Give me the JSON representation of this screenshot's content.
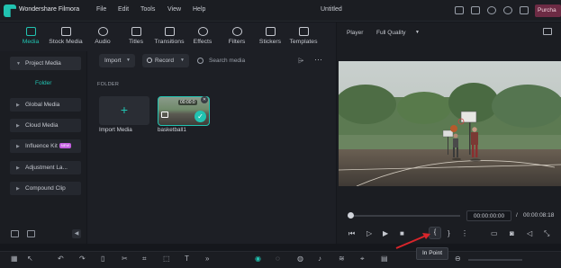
{
  "titlebar": {
    "app_name": "Wondershare Filmora",
    "menu": [
      "File",
      "Edit",
      "Tools",
      "View",
      "Help"
    ],
    "doc_title": "Untitled",
    "purchase": "Purcha"
  },
  "tabs": [
    "Media",
    "Stock Media",
    "Audio",
    "Titles",
    "Transitions",
    "Effects",
    "Filters",
    "Stickers",
    "Templates"
  ],
  "sidebar": {
    "items": [
      "Project Media",
      "Global Media",
      "Cloud Media",
      "Influence Kit",
      "Adjustment La...",
      "Compound Clip"
    ],
    "folder": "Folder",
    "new_badge": "NEW"
  },
  "media": {
    "import_label": "Import",
    "record_label": "Record",
    "search_placeholder": "Search media",
    "folder_header": "FOLDER",
    "import_card_label": "Import Media",
    "clip_name": "basketball1",
    "clip_duration": "00:00:0"
  },
  "player": {
    "label": "Player",
    "quality": "Full Quality",
    "current_time": "00:00:00:00",
    "separator": "/",
    "total_time": "00:00:08:18",
    "in_point_tooltip": "In Point"
  },
  "colors": {
    "accent": "#21c3b1",
    "background": "#15171c",
    "panel": "#1d1f25",
    "purchase": "#6d2b44"
  }
}
